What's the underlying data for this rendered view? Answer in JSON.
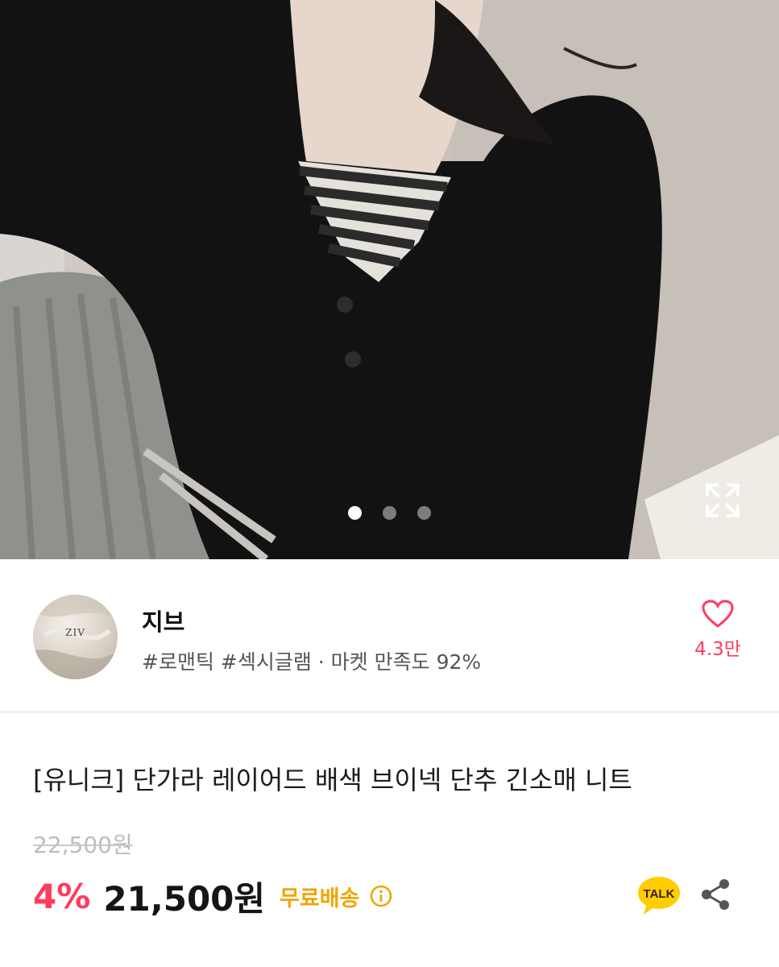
{
  "hero": {
    "image_label": "product-photo",
    "slide_count": 3,
    "active_slide": 1
  },
  "store": {
    "avatar_text": "ZIV",
    "name": "지브",
    "tags": "#로맨틱 #섹시글램 · 마켓 만족도 92%",
    "favorite_count": "4.3만"
  },
  "product": {
    "title": "[유니크] 단가라 레이어드 배색 브이넥 단추 긴소매 니트",
    "original_price": "22,500원",
    "discount": "4%",
    "price": "21,500원",
    "shipping": "무료배송"
  },
  "actions": {
    "talk_label": "TALK"
  },
  "colors": {
    "accent": "#ff3b5c",
    "shipping": "#f0a500",
    "talk_bubble": "#ffcd00"
  },
  "icons": [
    "expand-icon",
    "heart-icon",
    "info-icon",
    "kakao-talk-icon",
    "share-icon"
  ]
}
